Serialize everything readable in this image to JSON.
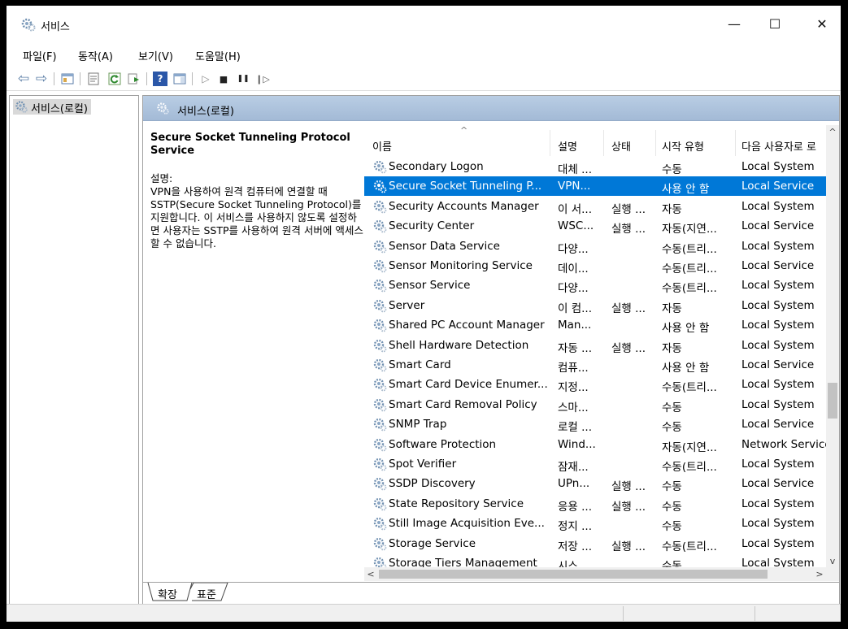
{
  "window": {
    "title": "서비스",
    "controls": {
      "minimize": "—",
      "maximize": "☐",
      "close": "✕"
    }
  },
  "menu": [
    {
      "label": "파일(F)"
    },
    {
      "label": "동작(A)"
    },
    {
      "label": "보기(V)"
    },
    {
      "label": "도움말(H)"
    }
  ],
  "toolbar": {
    "back_icon": "back-arrow-icon",
    "forward_icon": "forward-arrow-icon",
    "glyphs": {
      "back": "⇦",
      "forward": "⇨",
      "help": "?",
      "play": "▷",
      "stop": "■",
      "pause": "❚❚",
      "restart": "❙▷"
    }
  },
  "tree": {
    "root_label": "서비스(로컬)"
  },
  "panel": {
    "header": "서비스(로컬)"
  },
  "description": {
    "service_name": "Secure Socket Tunneling Protocol Service",
    "label": "설명:",
    "text": "VPN을 사용하여 원격 컴퓨터에 연결할 때 SSTP(Secure Socket Tunneling Protocol)를 지원합니다. 이 서비스를 사용하지 않도록 설정하면 사용자는 SSTP를 사용하여 원격 서버에 액세스할 수 없습니다."
  },
  "columns": {
    "sort_indicator": "^",
    "name": "이름",
    "desc": "설명",
    "status": "상태",
    "startup": "시작 유형",
    "logon": "다음 사용자로 로"
  },
  "rows": [
    {
      "name": "Secondary Logon",
      "desc": "대체 ...",
      "status": "",
      "startup": "수동",
      "logon": "Local System"
    },
    {
      "name": "Secure Socket Tunneling P...",
      "desc": "VPN...",
      "status": "",
      "startup": "사용 안 함",
      "logon": "Local Service",
      "selected": true
    },
    {
      "name": "Security Accounts Manager",
      "desc": "이 서...",
      "status": "실행 ...",
      "startup": "자동",
      "logon": "Local System"
    },
    {
      "name": "Security Center",
      "desc": "WSC...",
      "status": "실행 ...",
      "startup": "자동(지연...",
      "logon": "Local Service"
    },
    {
      "name": "Sensor Data Service",
      "desc": "다양...",
      "status": "",
      "startup": "수동(트리...",
      "logon": "Local System"
    },
    {
      "name": "Sensor Monitoring Service",
      "desc": "데이...",
      "status": "",
      "startup": "수동(트리...",
      "logon": "Local Service"
    },
    {
      "name": "Sensor Service",
      "desc": "다양...",
      "status": "",
      "startup": "수동(트리...",
      "logon": "Local System"
    },
    {
      "name": "Server",
      "desc": "이 컴...",
      "status": "실행 ...",
      "startup": "자동",
      "logon": "Local System"
    },
    {
      "name": "Shared PC Account Manager",
      "desc": "Man...",
      "status": "",
      "startup": "사용 안 함",
      "logon": "Local System"
    },
    {
      "name": "Shell Hardware Detection",
      "desc": "자동 ...",
      "status": "실행 ...",
      "startup": "자동",
      "logon": "Local System"
    },
    {
      "name": "Smart Card",
      "desc": "컴퓨...",
      "status": "",
      "startup": "사용 안 함",
      "logon": "Local Service"
    },
    {
      "name": "Smart Card Device Enumer...",
      "desc": "지정...",
      "status": "",
      "startup": "수동(트리...",
      "logon": "Local System"
    },
    {
      "name": "Smart Card Removal Policy",
      "desc": "스마...",
      "status": "",
      "startup": "수동",
      "logon": "Local System"
    },
    {
      "name": "SNMP Trap",
      "desc": "로컬 ...",
      "status": "",
      "startup": "수동",
      "logon": "Local Service"
    },
    {
      "name": "Software Protection",
      "desc": "Wind...",
      "status": "",
      "startup": "자동(지연...",
      "logon": "Network Service"
    },
    {
      "name": "Spot Verifier",
      "desc": "잠재...",
      "status": "",
      "startup": "수동(트리...",
      "logon": "Local System"
    },
    {
      "name": "SSDP Discovery",
      "desc": "UPn...",
      "status": "실행 ...",
      "startup": "수동",
      "logon": "Local Service"
    },
    {
      "name": "State Repository Service",
      "desc": "응용 ...",
      "status": "실행 ...",
      "startup": "수동",
      "logon": "Local System"
    },
    {
      "name": "Still Image Acquisition Eve...",
      "desc": "정지 ...",
      "status": "",
      "startup": "수동",
      "logon": "Local System"
    },
    {
      "name": "Storage Service",
      "desc": "저장 ...",
      "status": "실행 ...",
      "startup": "수동(트리...",
      "logon": "Local System"
    },
    {
      "name": "Storage Tiers Management",
      "desc": "시스...",
      "status": "",
      "startup": "수동",
      "logon": "Local System"
    }
  ],
  "scroll": {
    "up": "^",
    "down": "v",
    "left": "<",
    "right": ">"
  },
  "tabs": [
    {
      "label": "확장"
    },
    {
      "label": "표준"
    }
  ],
  "colors": {
    "selection": "#0078d7",
    "header_gradient": "#b9cde4"
  }
}
